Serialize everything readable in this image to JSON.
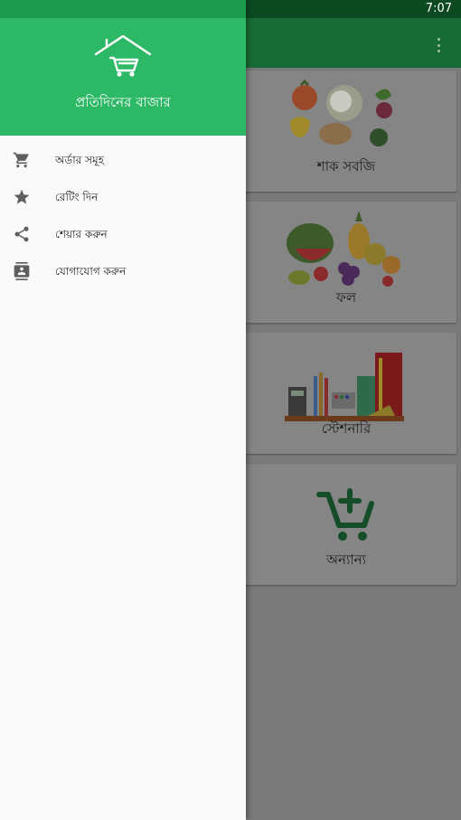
{
  "status_bar": {
    "time": "7:07"
  },
  "drawer": {
    "title": "প্রতিদিনের বাজার",
    "items": [
      {
        "label": "অর্ডার সমূহ",
        "icon": "cart-icon"
      },
      {
        "label": "রেটিং দিন",
        "icon": "star-icon"
      },
      {
        "label": "শেয়ার করুন",
        "icon": "share-icon"
      },
      {
        "label": "যোগাযোগ করুন",
        "icon": "contacts-icon"
      }
    ]
  },
  "categories": [
    {
      "label": "শাক সবজি",
      "icon": "vegetables-image"
    },
    {
      "label": "ফল",
      "icon": "fruits-image"
    },
    {
      "label": "স্টেশনারি",
      "icon": "stationery-image"
    },
    {
      "label": "অন্যান্য",
      "icon": "add-to-cart-icon"
    }
  ],
  "colors": {
    "drawer_header": "#2db866",
    "app_bar": "#176b34",
    "status_bar": "#0d4a22"
  }
}
